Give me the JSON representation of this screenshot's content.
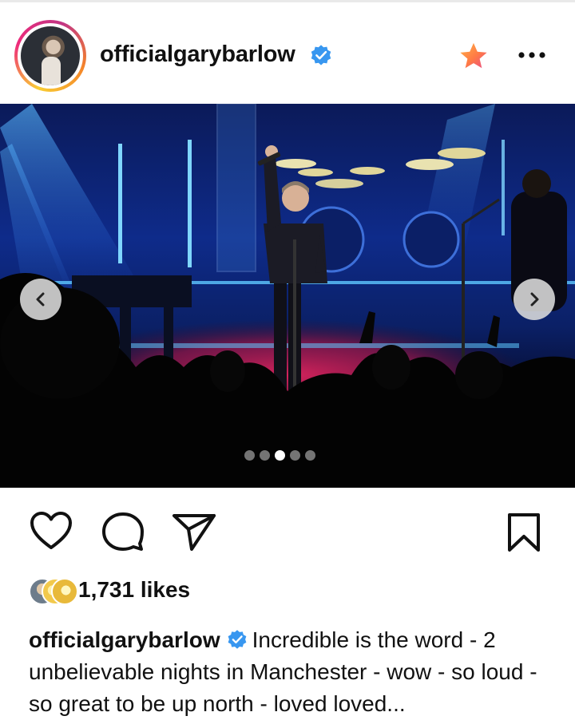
{
  "post": {
    "username": "officialgarybarlow",
    "verified": true,
    "carousel": {
      "total_slides": 5,
      "active_slide": 3
    },
    "likes": "1,731 likes",
    "caption_username": "officialgarybarlow",
    "caption_text": "Incredible is the word - 2 unbelievable nights in Manchester - wow - so loud - so great to be up north - loved loved..."
  },
  "icons": {
    "verified": "verified-badge-icon",
    "favorite": "star-icon",
    "more": "more-dots-icon",
    "prev": "chevron-left-icon",
    "next": "chevron-right-icon",
    "like": "heart-icon",
    "comment": "comment-bubble-icon",
    "share": "paper-plane-icon",
    "save": "bookmark-icon"
  },
  "colors": {
    "verified_blue": "#3897f0",
    "star_orange": "#ff7a45",
    "star_pink": "#e94b8a",
    "stage_blue": "#0e2b8a",
    "stage_red": "#c2184b"
  }
}
